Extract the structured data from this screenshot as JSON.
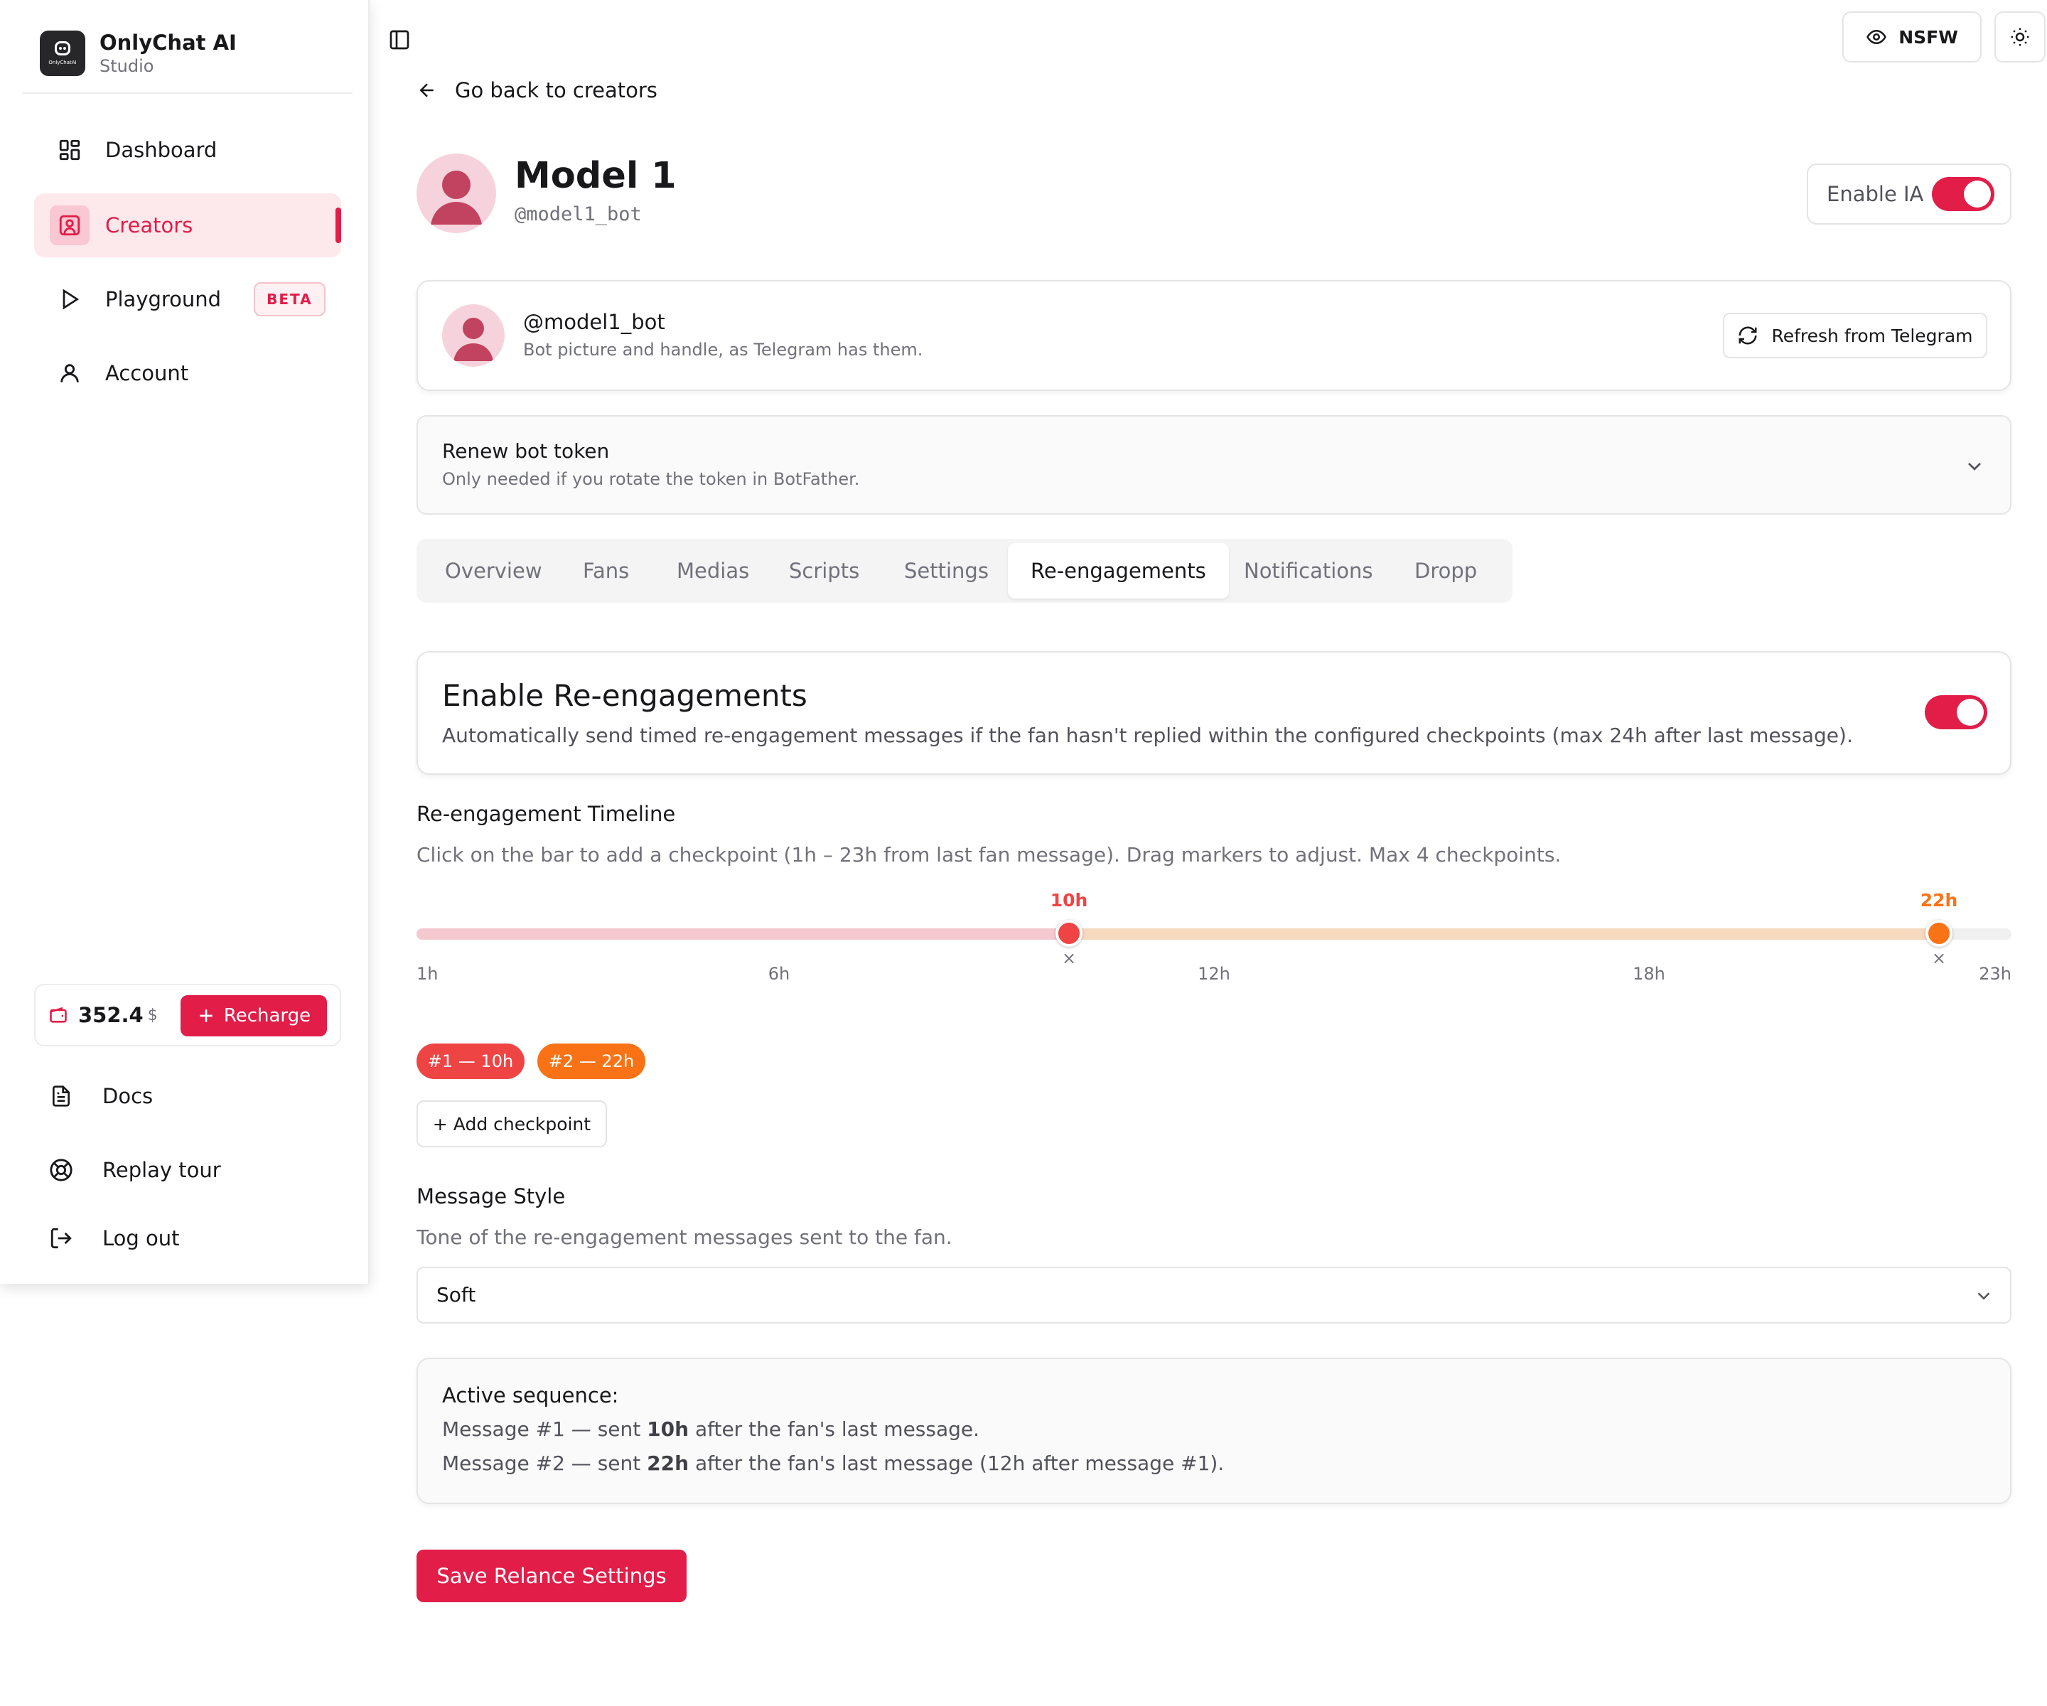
{
  "brand": {
    "name": "OnlyChat AI",
    "subtitle": "Studio",
    "logo_text": "OnlyChatAI"
  },
  "sidebar": {
    "items": [
      {
        "label": "Dashboard",
        "icon": "dashboard-icon"
      },
      {
        "label": "Creators",
        "icon": "creators-icon",
        "active": true
      },
      {
        "label": "Playground",
        "icon": "play-icon",
        "badge": "BETA"
      },
      {
        "label": "Account",
        "icon": "user-icon"
      }
    ],
    "balance": {
      "amount": "352.4",
      "currency": "$"
    },
    "recharge_label": "Recharge",
    "footer": [
      {
        "label": "Docs",
        "icon": "document-icon"
      },
      {
        "label": "Replay tour",
        "icon": "lifebuoy-icon"
      },
      {
        "label": "Log out",
        "icon": "logout-icon"
      }
    ]
  },
  "topbar": {
    "nsfw_label": "NSFW"
  },
  "back_label": "Go back to creators",
  "model": {
    "name": "Model 1",
    "handle": "@model1_bot",
    "enable_ia_label": "Enable IA",
    "enable_ia": true
  },
  "bot_card": {
    "handle": "@model1_bot",
    "description": "Bot picture and handle, as Telegram has them.",
    "refresh_label": "Refresh from Telegram"
  },
  "renew": {
    "title": "Renew bot token",
    "description": "Only needed if you rotate the token in BotFather."
  },
  "tabs": [
    "Overview",
    "Fans",
    "Medias",
    "Scripts",
    "Settings",
    "Re-engagements",
    "Notifications",
    "Dropp"
  ],
  "active_tab": "Re-engagements",
  "reengage": {
    "title": "Enable Re-engagements",
    "description": "Automatically send timed re-engagement messages if the fan hasn't replied within the configured checkpoints (max 24h after last message).",
    "enabled": true
  },
  "timeline": {
    "title": "Re-engagement Timeline",
    "description": "Click on the bar to add a checkpoint (1h – 23h from last fan message). Drag markers to adjust. Max 4 checkpoints.",
    "range": [
      1,
      23
    ],
    "ticks": [
      "1h",
      "6h",
      "12h",
      "18h",
      "23h"
    ],
    "checkpoints": [
      {
        "hours": 10,
        "label": "10h",
        "pill": "#1 — 10h",
        "color": "#ef4444"
      },
      {
        "hours": 22,
        "label": "22h",
        "pill": "#2 — 22h",
        "color": "#f97316"
      }
    ],
    "remove_glyph": "×",
    "add_label": "+ Add checkpoint"
  },
  "style": {
    "title": "Message Style",
    "description": "Tone of the re-engagement messages sent to the fan.",
    "value": "Soft"
  },
  "sequence": {
    "title": "Active sequence:",
    "lines": [
      {
        "prefix": "Message #1 — sent ",
        "bold": "10h",
        "suffix": " after the fan's last message."
      },
      {
        "prefix": "Message #2 — sent ",
        "bold": "22h",
        "suffix": " after the fan's last message (12h after message #1)."
      }
    ]
  },
  "save_label": "Save Relance Settings",
  "colors": {
    "accent": "#e11d48",
    "checkpoint1": "#ef4444",
    "checkpoint2": "#f97316"
  }
}
